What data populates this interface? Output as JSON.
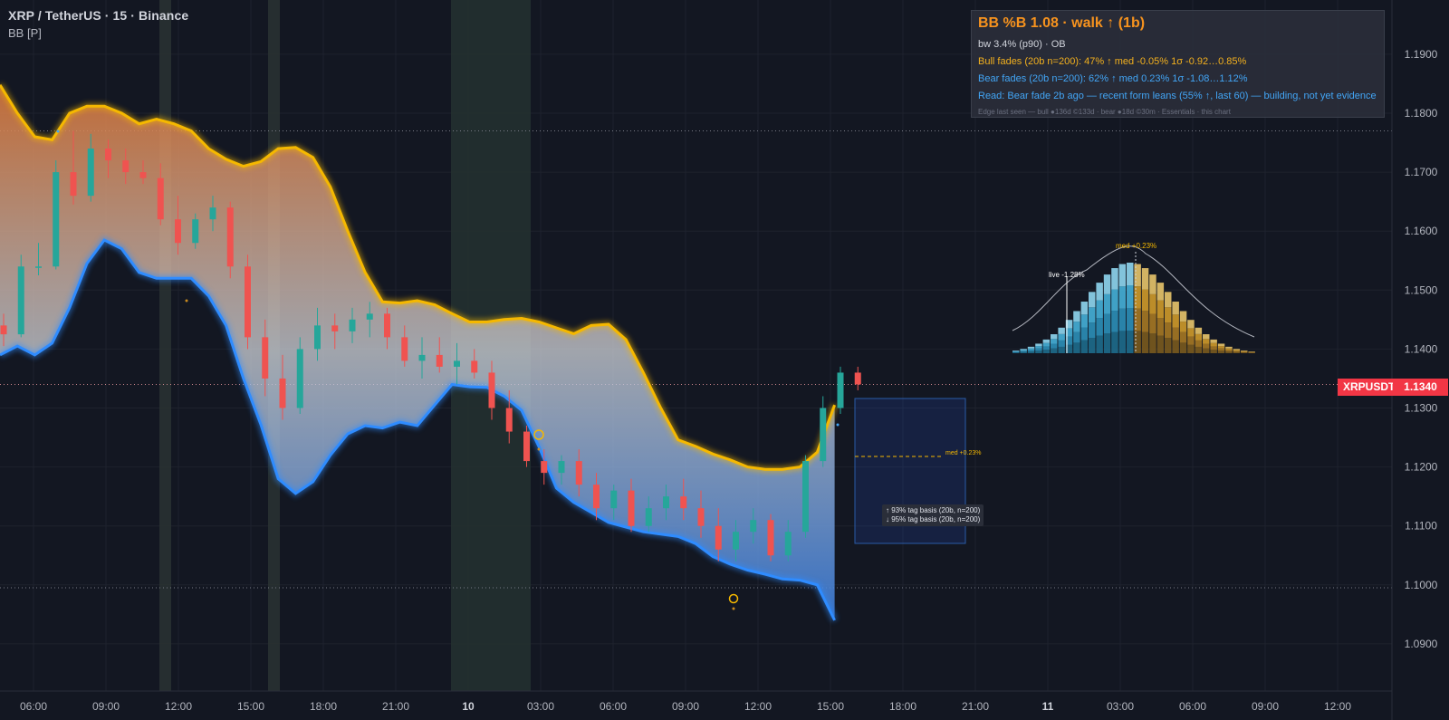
{
  "header": {
    "title": "XRP / TetherUS · 15 · Binance",
    "indicator": "BB [P]"
  },
  "panel": {
    "title": "BB  %B 1.08 · walk ↑ (1b)",
    "line2": "bw 3.4% (p90) · OB",
    "line3": "Bull fades (20b n=200):  47% ↑  med -0.05%  1σ -0.92…0.85%",
    "line4": "Bear fades (20b n=200):  62% ↑  med 0.23%  1σ -1.08…1.12%",
    "line5": "Read: Bear fade 2b ago — recent form leans (55% ↑, last 60) — building, not yet evidence",
    "line6": "Edge last seen — bull ●136d ©133d · bear ●18d ©30m · Essentials · this chart"
  },
  "histogram": {
    "live_label": "live -1.28%",
    "med_label": "med +0.23%"
  },
  "projection": {
    "med_label": "med +0.23%",
    "tooltip_line1": "↑ 93% tag basis (20b, n=200)",
    "tooltip_line2": "↓ 95% tag basis (20b, n=200)"
  },
  "price_scale": {
    "symbol": "XRPUSDT",
    "last_price": "1.1340"
  },
  "colors": {
    "background": "#131722",
    "up": "#26a69a",
    "down": "#ef5350",
    "upper_band": "#f5b800",
    "lower_band": "#2f8cff",
    "last_price": "#f23645"
  },
  "chart_data": {
    "type": "candlestick",
    "title": "XRP / TetherUS · 15 · Binance",
    "y_ticks": [
      "1.1900",
      "1.1800",
      "1.1700",
      "1.1600",
      "1.1500",
      "1.1400",
      "1.1300",
      "1.1200",
      "1.1100",
      "1.1000",
      "1.0900"
    ],
    "ylim": [
      1.0815,
      1.1975
    ],
    "x_ticks": [
      "06:00",
      "09:00",
      "12:00",
      "15:00",
      "18:00",
      "21:00",
      "10",
      "03:00",
      "06:00",
      "09:00",
      "12:00",
      "15:00",
      "18:00",
      "21:00",
      "11",
      "03:00",
      "06:00",
      "09:00",
      "12:00"
    ],
    "session_dates": [
      "10",
      "11"
    ],
    "dotted_levels": [
      1.177,
      1.134,
      1.0995
    ],
    "upper_band": [
      [
        0,
        1.1848
      ],
      [
        1,
        1.18
      ],
      [
        2,
        1.176
      ],
      [
        3,
        1.1755
      ],
      [
        4,
        1.18
      ],
      [
        5,
        1.1812
      ],
      [
        6,
        1.1812
      ],
      [
        7,
        1.18
      ],
      [
        8,
        1.1782
      ],
      [
        9,
        1.179
      ],
      [
        10,
        1.1782
      ],
      [
        11,
        1.177
      ],
      [
        12,
        1.174
      ],
      [
        13,
        1.1722
      ],
      [
        14,
        1.171
      ],
      [
        15,
        1.1718
      ],
      [
        16,
        1.174
      ],
      [
        17,
        1.1742
      ],
      [
        18,
        1.1725
      ],
      [
        19,
        1.1675
      ],
      [
        20,
        1.16
      ],
      [
        21,
        1.153
      ],
      [
        22,
        1.148
      ],
      [
        23,
        1.1478
      ],
      [
        24,
        1.1482
      ],
      [
        25,
        1.1475
      ],
      [
        26,
        1.146
      ],
      [
        27,
        1.1446
      ],
      [
        28,
        1.1446
      ],
      [
        29,
        1.145
      ],
      [
        30,
        1.1452
      ],
      [
        31,
        1.1446
      ],
      [
        32,
        1.1436
      ],
      [
        33,
        1.1426
      ],
      [
        34,
        1.144
      ],
      [
        35,
        1.1442
      ],
      [
        36,
        1.1416
      ],
      [
        37,
        1.136
      ],
      [
        38,
        1.13
      ],
      [
        39,
        1.1246
      ],
      [
        40,
        1.1235
      ],
      [
        41,
        1.1222
      ],
      [
        42,
        1.1212
      ],
      [
        43,
        1.12
      ],
      [
        44,
        1.1196
      ],
      [
        45,
        1.1196
      ],
      [
        46,
        1.12
      ],
      [
        47,
        1.1225
      ],
      [
        48,
        1.1305
      ]
    ],
    "lower_band": [
      [
        0,
        1.139
      ],
      [
        1,
        1.1405
      ],
      [
        2,
        1.139
      ],
      [
        3,
        1.141
      ],
      [
        4,
        1.147
      ],
      [
        5,
        1.1545
      ],
      [
        6,
        1.1585
      ],
      [
        7,
        1.157
      ],
      [
        8,
        1.153
      ],
      [
        9,
        1.152
      ],
      [
        10,
        1.152
      ],
      [
        11,
        1.152
      ],
      [
        12,
        1.149
      ],
      [
        13,
        1.144
      ],
      [
        14,
        1.135
      ],
      [
        15,
        1.1272
      ],
      [
        16,
        1.118
      ],
      [
        17,
        1.1155
      ],
      [
        18,
        1.1175
      ],
      [
        19,
        1.122
      ],
      [
        20,
        1.1256
      ],
      [
        21,
        1.127
      ],
      [
        22,
        1.1266
      ],
      [
        23,
        1.1276
      ],
      [
        24,
        1.127
      ],
      [
        25,
        1.1305
      ],
      [
        26,
        1.134
      ],
      [
        27,
        1.1336
      ],
      [
        28,
        1.1335
      ],
      [
        29,
        1.132
      ],
      [
        30,
        1.1296
      ],
      [
        31,
        1.1234
      ],
      [
        32,
        1.1164
      ],
      [
        33,
        1.114
      ],
      [
        34,
        1.1123
      ],
      [
        35,
        1.1106
      ],
      [
        36,
        1.1098
      ],
      [
        37,
        1.109
      ],
      [
        38,
        1.1086
      ],
      [
        39,
        1.1082
      ],
      [
        40,
        1.107
      ],
      [
        41,
        1.1048
      ],
      [
        42,
        1.1035
      ],
      [
        43,
        1.1025
      ],
      [
        44,
        1.1018
      ],
      [
        45,
        1.101
      ],
      [
        46,
        1.1008
      ],
      [
        47,
        1.1
      ],
      [
        48,
        1.094
      ]
    ],
    "candles": [
      [
        0,
        1.144,
        1.146,
        1.1405,
        1.1425
      ],
      [
        1,
        1.1425,
        1.156,
        1.142,
        1.154
      ],
      [
        2,
        1.154,
        1.158,
        1.1525,
        1.154
      ],
      [
        3,
        1.154,
        1.172,
        1.1535,
        1.17
      ],
      [
        4,
        1.17,
        1.177,
        1.1645,
        1.166
      ],
      [
        5,
        1.166,
        1.1765,
        1.165,
        1.174
      ],
      [
        6,
        1.174,
        1.1755,
        1.169,
        1.172
      ],
      [
        7,
        1.172,
        1.174,
        1.168,
        1.17
      ],
      [
        8,
        1.17,
        1.172,
        1.168,
        1.169
      ],
      [
        9,
        1.169,
        1.1715,
        1.161,
        1.162
      ],
      [
        10,
        1.162,
        1.166,
        1.156,
        1.158
      ],
      [
        11,
        1.158,
        1.163,
        1.157,
        1.162
      ],
      [
        12,
        1.162,
        1.166,
        1.16,
        1.164
      ],
      [
        13,
        1.164,
        1.165,
        1.152,
        1.154
      ],
      [
        14,
        1.154,
        1.156,
        1.14,
        1.142
      ],
      [
        15,
        1.142,
        1.145,
        1.132,
        1.135
      ],
      [
        16,
        1.135,
        1.139,
        1.128,
        1.13
      ],
      [
        17,
        1.13,
        1.142,
        1.129,
        1.14
      ],
      [
        18,
        1.14,
        1.147,
        1.138,
        1.144
      ],
      [
        19,
        1.144,
        1.146,
        1.14,
        1.143
      ],
      [
        20,
        1.143,
        1.147,
        1.141,
        1.145
      ],
      [
        21,
        1.145,
        1.148,
        1.142,
        1.146
      ],
      [
        22,
        1.146,
        1.147,
        1.14,
        1.142
      ],
      [
        23,
        1.142,
        1.144,
        1.137,
        1.138
      ],
      [
        24,
        1.138,
        1.142,
        1.135,
        1.139
      ],
      [
        25,
        1.139,
        1.142,
        1.136,
        1.137
      ],
      [
        26,
        1.137,
        1.141,
        1.134,
        1.138
      ],
      [
        27,
        1.138,
        1.14,
        1.135,
        1.136
      ],
      [
        28,
        1.136,
        1.138,
        1.128,
        1.13
      ],
      [
        29,
        1.13,
        1.133,
        1.124,
        1.126
      ],
      [
        30,
        1.126,
        1.127,
        1.12,
        1.121
      ],
      [
        31,
        1.121,
        1.123,
        1.117,
        1.119
      ],
      [
        32,
        1.119,
        1.122,
        1.117,
        1.121
      ],
      [
        33,
        1.121,
        1.123,
        1.115,
        1.117
      ],
      [
        34,
        1.117,
        1.119,
        1.111,
        1.113
      ],
      [
        35,
        1.113,
        1.117,
        1.111,
        1.116
      ],
      [
        36,
        1.116,
        1.118,
        1.109,
        1.11
      ],
      [
        37,
        1.11,
        1.115,
        1.109,
        1.113
      ],
      [
        38,
        1.113,
        1.117,
        1.111,
        1.115
      ],
      [
        39,
        1.115,
        1.118,
        1.111,
        1.113
      ],
      [
        40,
        1.113,
        1.116,
        1.108,
        1.11
      ],
      [
        41,
        1.11,
        1.113,
        1.104,
        1.106
      ],
      [
        42,
        1.106,
        1.111,
        1.104,
        1.109
      ],
      [
        43,
        1.109,
        1.113,
        1.107,
        1.111
      ],
      [
        44,
        1.111,
        1.112,
        1.104,
        1.105
      ],
      [
        45,
        1.105,
        1.111,
        1.104,
        1.109
      ],
      [
        46,
        1.109,
        1.122,
        1.108,
        1.121
      ],
      [
        47,
        1.121,
        1.132,
        1.12,
        1.13
      ],
      [
        48,
        1.13,
        1.137,
        1.129,
        1.136
      ],
      [
        49,
        1.136,
        1.137,
        1.133,
        1.134
      ]
    ]
  }
}
